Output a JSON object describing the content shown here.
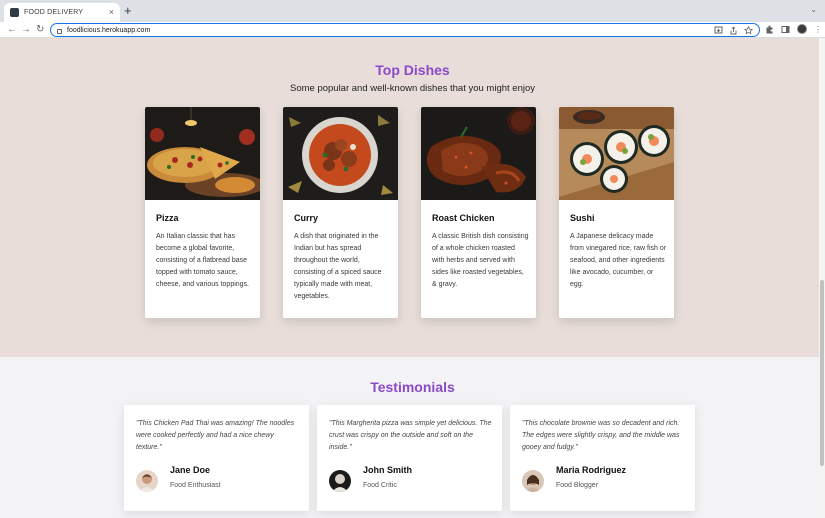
{
  "browser": {
    "tab_title": "FOOD DELIVERY",
    "tab_close": "×",
    "new_tab": "+",
    "tabs_menu": "⌄",
    "back": "←",
    "forward": "→",
    "reload": "↻",
    "url": "foodlicious.herokuapp.com",
    "menu": "⋮"
  },
  "top_dishes": {
    "title": "Top Dishes",
    "subtitle": "Some popular and well-known dishes that you might enjoy",
    "items": [
      {
        "name": "Pizza",
        "description": "An Italian classic that has become a global favorite, consisting of a flatbread base topped with tomato sauce, cheese, and various toppings."
      },
      {
        "name": "Curry",
        "description": "A dish that originated in the Indian but has spread throughout the world, consisting of a spiced sauce typically made with meat, vegetables."
      },
      {
        "name": "Roast Chicken",
        "description": "A classic British dish consisting of a whole chicken roasted with herbs and served with sides like roasted vegetables, & gravy."
      },
      {
        "name": "Sushi",
        "description": "A Japanese delicacy made from vinegared rice, raw fish or seafood, and other ingredients like avocado, cucumber, or egg."
      }
    ]
  },
  "testimonials": {
    "title": "Testimonials",
    "items": [
      {
        "quote": "\"This Chicken Pad Thai was amazing! The noodles were cooked perfectly and had a nice chewy texture.\"",
        "name": "Jane Doe",
        "role": "Food Enthusiast"
      },
      {
        "quote": "\"This Margherita pizza was simple yet delicious. The crust was crispy on the outside and soft on the inside.\"",
        "name": "John Smith",
        "role": "Food Critic"
      },
      {
        "quote": "\"This chocolate brownie was so decadent and rich. The edges were slightly crispy, and the middle was gooey and fudgy.\"",
        "name": "Maria Rodriguez",
        "role": "Food Blogger"
      }
    ]
  },
  "colors": {
    "accent": "#8a49c9",
    "dishes_bg": "#e8ddd9",
    "testimonials_bg": "#f3f3f5"
  }
}
